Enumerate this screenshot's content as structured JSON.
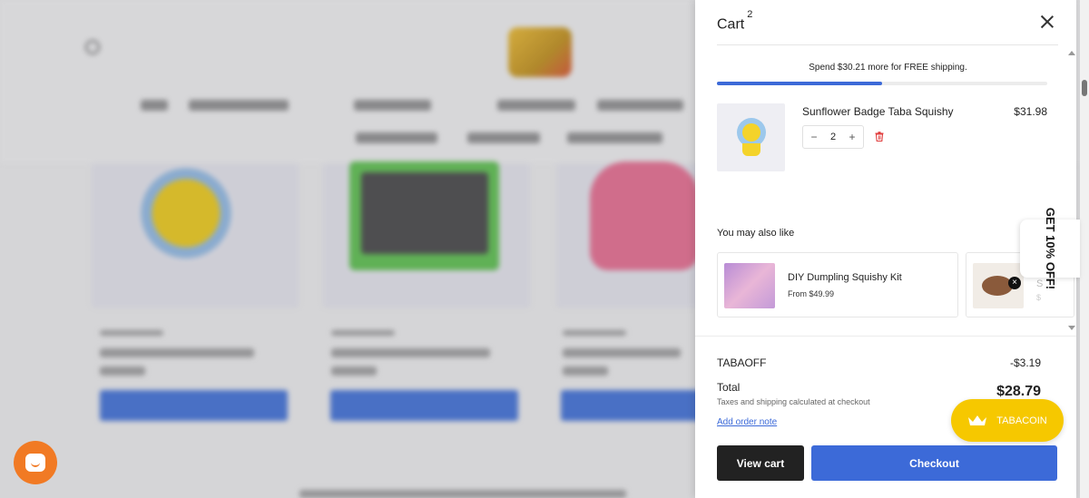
{
  "cart": {
    "title": "Cart",
    "count": "2",
    "shipping_message": "Spend $30.21 more for FREE shipping.",
    "shipping_progress": 0.5,
    "items": [
      {
        "name": "Sunflower Badge Taba Squishy",
        "price": "$31.98",
        "quantity": "2",
        "thumb_icon": "sunflower-badge-squishy-image"
      }
    ],
    "upsell": {
      "title": "You may also like",
      "products": [
        {
          "name": "DIY Dumpling Squishy Kit",
          "price": "From $49.99"
        },
        {
          "name": "S",
          "price": "$"
        }
      ]
    },
    "discount": {
      "code": "TABAOFF",
      "amount": "-$3.19"
    },
    "total": {
      "label": "Total",
      "value": "$28.79",
      "note": "Taxes and shipping calculated at checkout"
    },
    "order_note_link": "Add order note",
    "view_cart_label": "View cart",
    "checkout_label": "Checkout"
  },
  "widgets": {
    "tabacoin_label": "TABACOIN",
    "promo_label": "GET 10% OFF!",
    "promo_close": "×"
  },
  "colors": {
    "accent": "#3c6ad8",
    "checkout": "#3c6ad8",
    "view_cart": "#222222",
    "tabacoin": "#f6c800",
    "chat": "#f17a24",
    "remove": "#e03c3c"
  },
  "icons": [
    "close-icon",
    "minus-icon",
    "plus-icon",
    "trash-icon",
    "crown-icon",
    "chat-icon",
    "search-icon"
  ]
}
